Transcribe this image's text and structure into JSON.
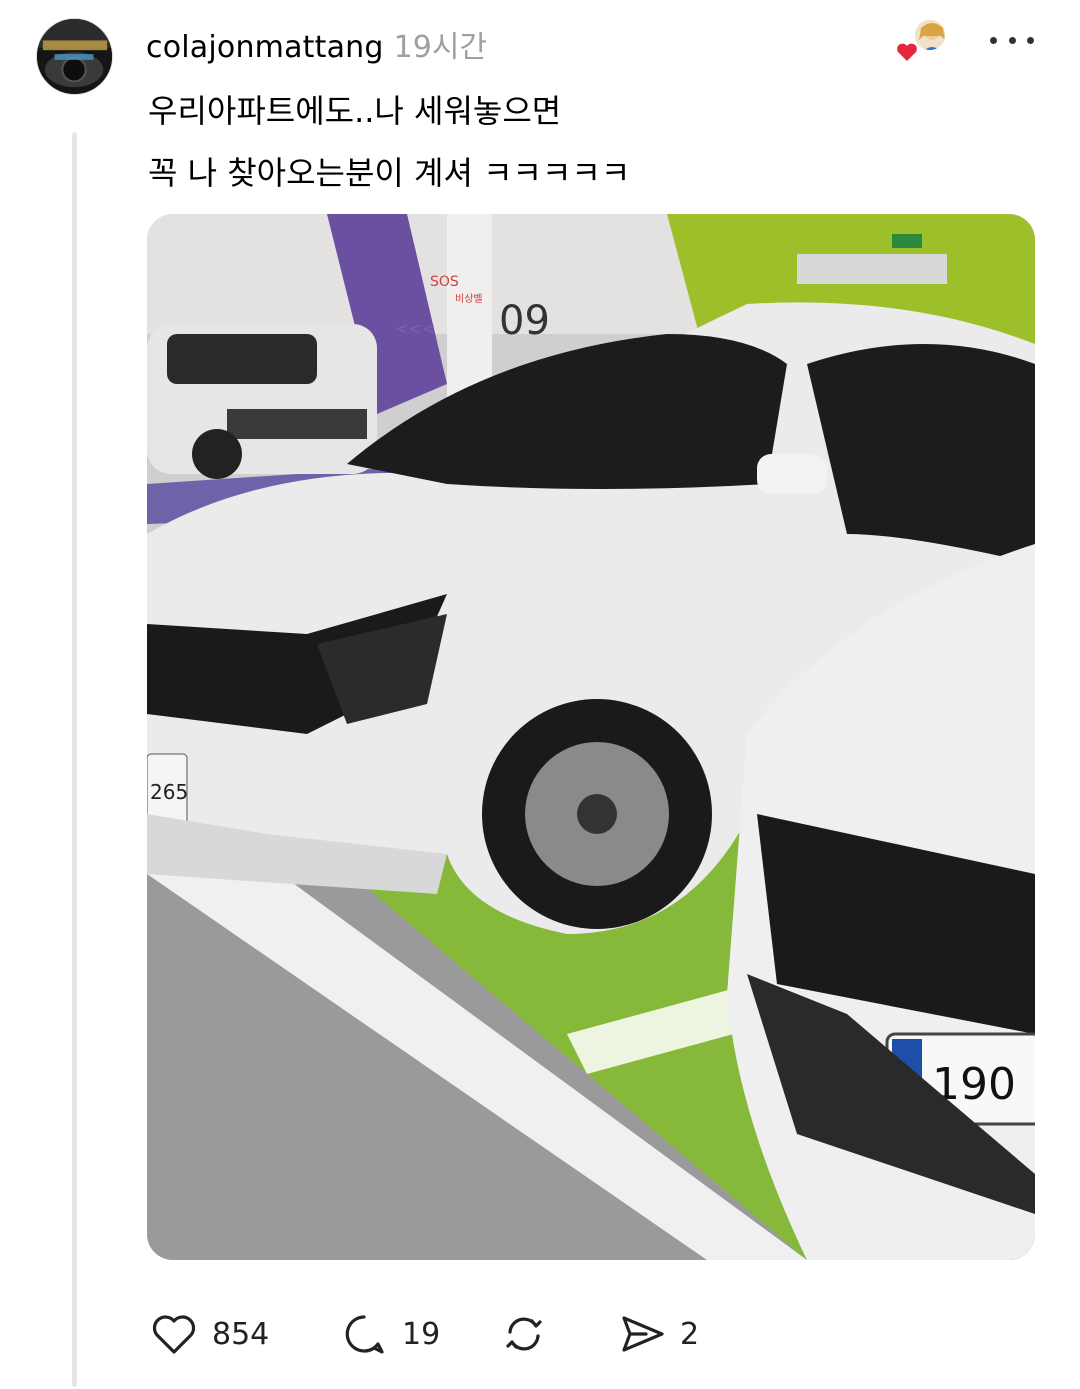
{
  "post": {
    "username": "colajonmattang",
    "timestamp": "19시간",
    "text_lines": [
      "우리아파트에도..나 세워놓으면",
      "꼭 나 찾아오는분이 계셔 ㅋㅋㅋㅋㅋ"
    ],
    "photo_text": {
      "sos": "SOS",
      "emergency_bell": "비상벨",
      "pillar_number": "09",
      "left_plate": "265",
      "right_plate": "190"
    }
  },
  "actions": {
    "like_count": "854",
    "reply_count": "19",
    "share_count": "2"
  },
  "colors": {
    "heart": "#e5263f",
    "timestamp": "#a0a0a0",
    "parking_green": "#86b839",
    "thread_line": "#e6e6e6"
  },
  "icons": [
    "avatar",
    "liker-avatar",
    "heart-icon",
    "more-icon",
    "like-icon",
    "reply-icon",
    "repost-icon",
    "share-icon"
  ]
}
